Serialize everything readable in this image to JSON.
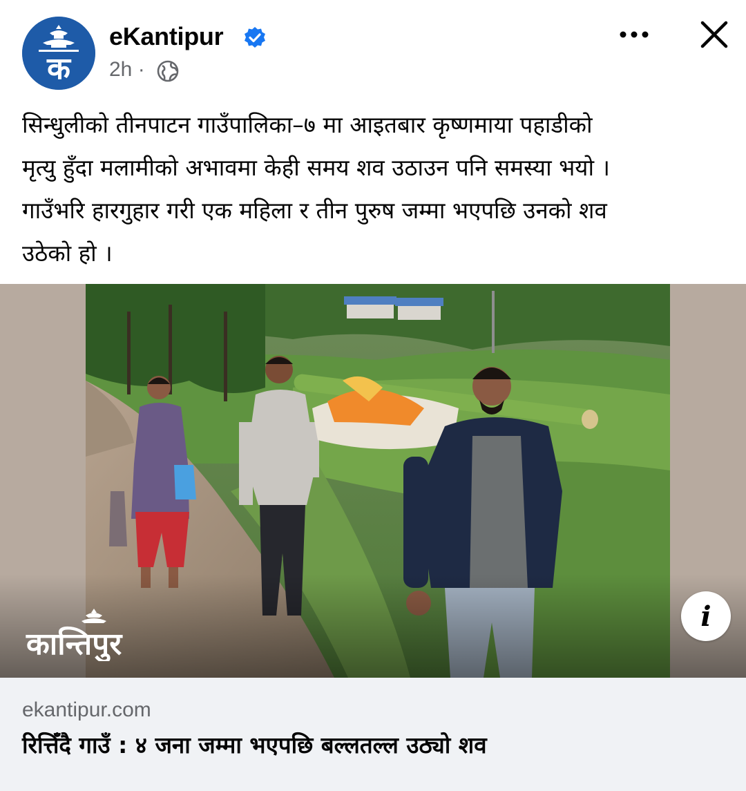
{
  "post": {
    "page_name": "eKantipur",
    "avatar_letter": "क",
    "time": "2h",
    "separator": "·",
    "caption_lines": [
      "सिन्धुलीको तीनपाटन गाउँपालिका–७ मा आइतबार कृष्णमाया पहाडीको",
      "मृत्यु हुँदा मलामीको अभावमा केही समय शव उठाउन पनि समस्या भयो ।",
      "गाउँभरि हारगुहार गरी एक महिला र तीन पुरुष जम्मा भएपछि उनको शव",
      "उठेको हो ।"
    ]
  },
  "media": {
    "watermark": "कान्तिपुर",
    "info_label": "i"
  },
  "link_preview": {
    "domain": "ekantipur.com",
    "title": "रित्तिँदै गाउँ : ४ जना जम्मा भएपछि बल्लतल्ल उठ्यो शव"
  },
  "icons": {
    "verified": "verified-badge-icon",
    "audience": "globe-icon",
    "more": "more-options-icon",
    "close": "close-icon",
    "info": "info-icon"
  },
  "colors": {
    "brand_blue": "#1e5ba8",
    "verified_blue": "#1877f2",
    "secondary_text": "#65676b",
    "link_bg": "#f0f2f5"
  }
}
